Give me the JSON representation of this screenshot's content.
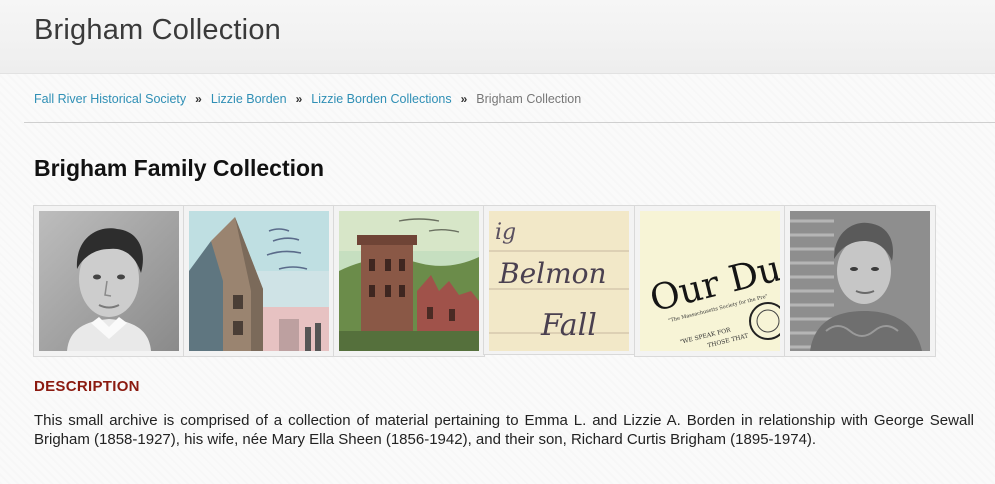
{
  "header": {
    "site_title": "Brigham Collection"
  },
  "breadcrumb": {
    "items": [
      {
        "label": "Fall River Historical Society"
      },
      {
        "label": "Lizzie Borden"
      },
      {
        "label": "Lizzie Borden Collections"
      }
    ],
    "separator": "»",
    "current": "Brigham Collection"
  },
  "main": {
    "heading": "Brigham Family Collection",
    "gallery": [
      {
        "icon": "portrait-boy-photo"
      },
      {
        "icon": "stone-building-postcard"
      },
      {
        "icon": "castle-tower-postcard"
      },
      {
        "icon": "handwritten-letter"
      },
      {
        "icon": "our-dumb-animals-masthead"
      },
      {
        "icon": "portrait-woman-photo"
      }
    ],
    "gallery_text": {
      "letter_line1": "ig",
      "letter_line2": "Belmon",
      "letter_line3": "Fall",
      "masthead_title": "Our Du",
      "masthead_subtitle": "\"The Massachusetts Society for the Pre\"",
      "masthead_motto": "\"WE SPEAK FOR",
      "masthead_motto2": "THOSE THAT"
    },
    "description": {
      "heading": "DESCRIPTION",
      "text": "This small archive is comprised of a collection of material pertaining to Emma L. and Lizzie A. Borden in relationship with George Sewall Brigham (1858-1927), his wife, née Mary Ella Sheen (1856-1942), and their son, Richard Curtis Brigham (1895-1974)."
    }
  }
}
